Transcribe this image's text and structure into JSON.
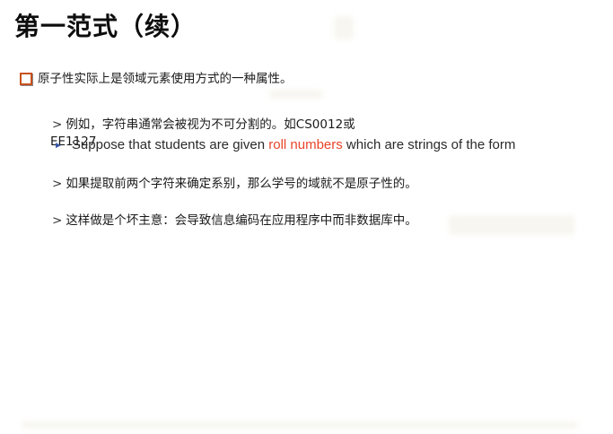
{
  "slide": {
    "title": "第一范式（续）",
    "main_bullet": "原子性实际上是领域元素使用方式的一种属性。",
    "sub_items": [
      {
        "arrow": ">",
        "text": "例如，字符串通常会被视为不可分割的。如CS0012或"
      },
      {
        "arrow": ">",
        "text": "如果提取前两个字符来确定系别，那么学号的域就不是原子性的。"
      },
      {
        "arrow": ">",
        "text": "这样做是个坏主意：会导致信息编码在应用程序中而非数据库中。"
      }
    ],
    "sub1_continuation": "EE1127",
    "overlay": {
      "before": "Suppose that students are given ",
      "highlight": "roll numbers",
      "after": " which are strings of the form"
    }
  },
  "colors": {
    "bullet_border": "#c8511b",
    "highlight": "#e8442a",
    "overlay_arrow": "#3b59a8"
  },
  "icons": {
    "main_bullet": "square-bullet-icon",
    "sub_bullet": "chevron-right-icon",
    "overlay_bullet": "triangle-right-icon"
  }
}
